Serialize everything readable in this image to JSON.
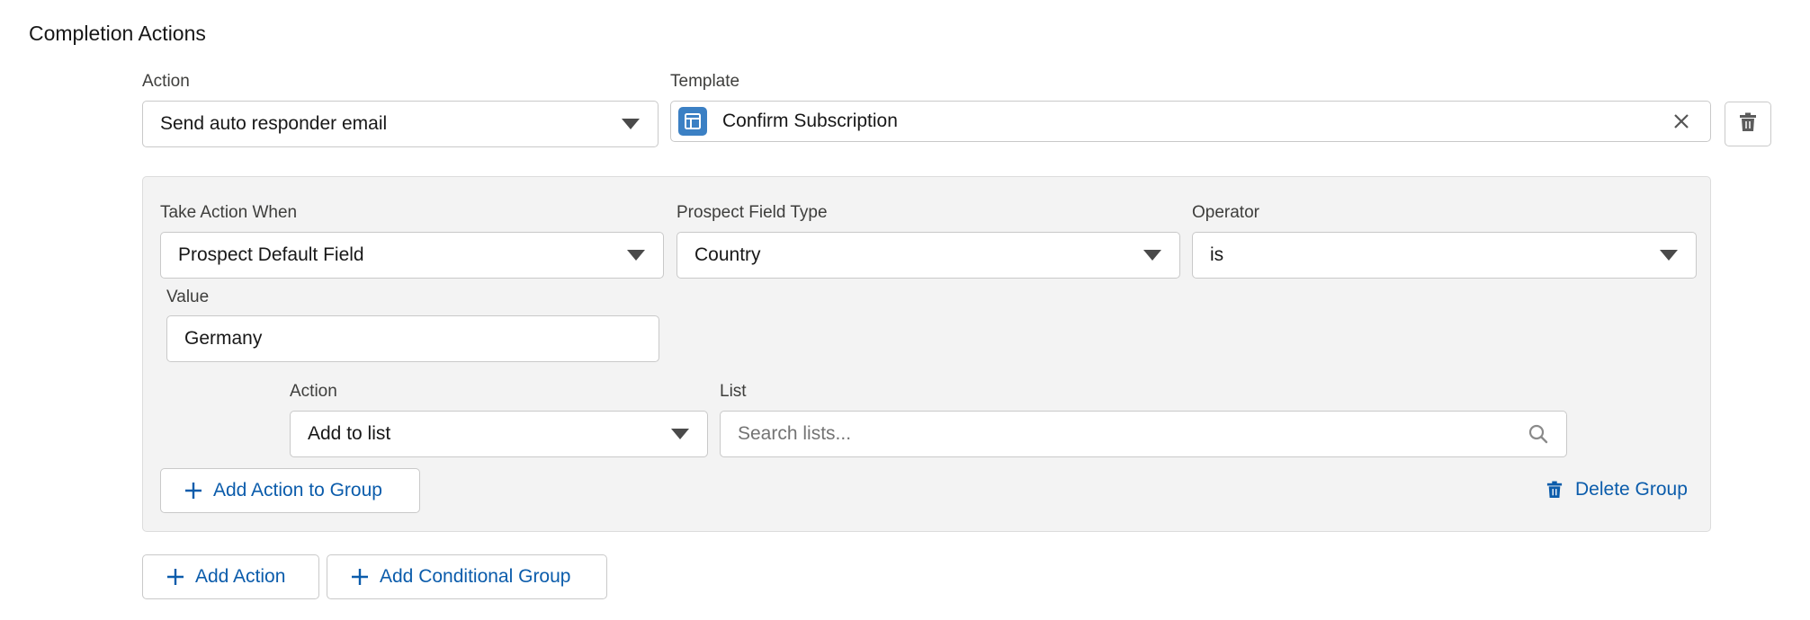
{
  "section": {
    "title": "Completion Actions"
  },
  "action_row": {
    "action_label": "Action",
    "action_value": "Send auto responder email",
    "template_label": "Template",
    "template_value": "Confirm Subscription"
  },
  "group": {
    "take_action_when_label": "Take Action When",
    "take_action_when_value": "Prospect Default Field",
    "prospect_field_type_label": "Prospect Field Type",
    "prospect_field_type_value": "Country",
    "operator_label": "Operator",
    "operator_value": "is",
    "value_label": "Value",
    "value_value": "Germany",
    "inner_action_label": "Action",
    "inner_action_value": "Add to list",
    "list_label": "List",
    "list_placeholder": "Search lists...",
    "add_action_to_group_label": "Add Action to Group",
    "delete_group_label": "Delete Group"
  },
  "footer": {
    "add_action_label": "Add Action",
    "add_conditional_group_label": "Add Conditional Group"
  },
  "colors": {
    "brand_blue": "#0b5cab",
    "template_icon_bg": "#3b80c4",
    "panel_bg": "#f3f3f3",
    "border": "#c9c9c9"
  },
  "icons": [
    "chevron-down-icon",
    "template-icon",
    "close-icon",
    "trash-icon",
    "search-icon",
    "plus-icon"
  ]
}
